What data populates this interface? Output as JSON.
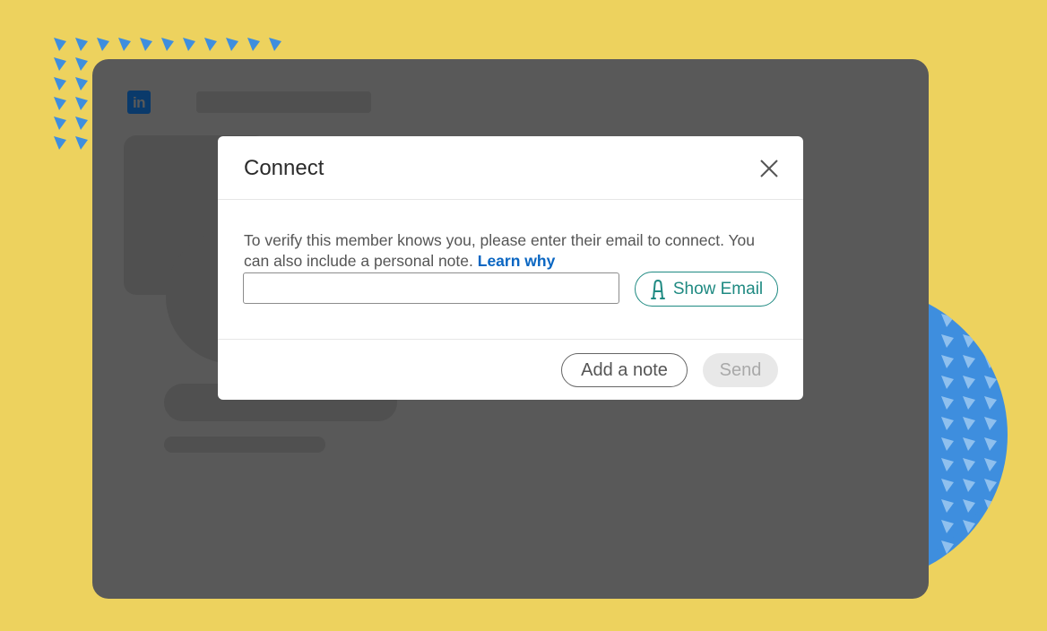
{
  "brand": {
    "logo_text": "in",
    "logo_color": "#0A3A6B"
  },
  "colors": {
    "background": "#EDD25E",
    "window": "#595959",
    "accent_blue": "#3E8EDE",
    "teal": "#1F8A82",
    "link": "#0A66C2"
  },
  "modal": {
    "title": "Connect",
    "close_icon": "close-icon",
    "description": "To verify this member knows you, please enter their email to connect. You can also include a personal note.",
    "learn_link": "Learn why",
    "email_input": {
      "value": "",
      "placeholder": ""
    },
    "show_email_button": {
      "label": "Show Email",
      "icon": "extension-icon"
    },
    "footer": {
      "add_note_label": "Add a note",
      "send_label": "Send"
    }
  }
}
